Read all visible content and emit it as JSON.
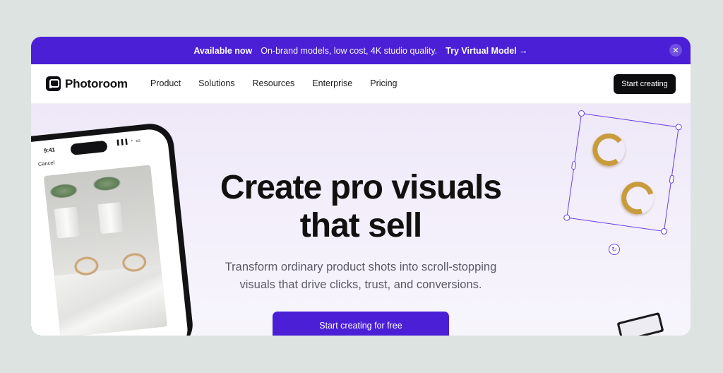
{
  "banner": {
    "lead": "Available now",
    "message": "On-brand models, low cost, 4K studio quality.",
    "cta": "Try Virtual Model →",
    "close": "✕"
  },
  "nav": {
    "brand": "Photoroom",
    "links": [
      "Product",
      "Solutions",
      "Resources",
      "Enterprise",
      "Pricing"
    ],
    "cta": "Start creating"
  },
  "hero": {
    "title_line1": "Create pro visuals",
    "title_line2": "that sell",
    "subtitle_line1": "Transform ordinary product shots into scroll-stopping",
    "subtitle_line2": "visuals that drive clicks, trust, and conversions.",
    "cta": "Start creating for free"
  },
  "phone": {
    "time": "9:41",
    "status": "▐▐▐ ◔ ▭",
    "cancel": "Cancel"
  },
  "editor": {
    "rotate_glyph": "↻"
  },
  "colors": {
    "brand_purple": "#4a1fd6",
    "selection_purple": "#6a3de8",
    "dark_button": "#0d0d10"
  }
}
